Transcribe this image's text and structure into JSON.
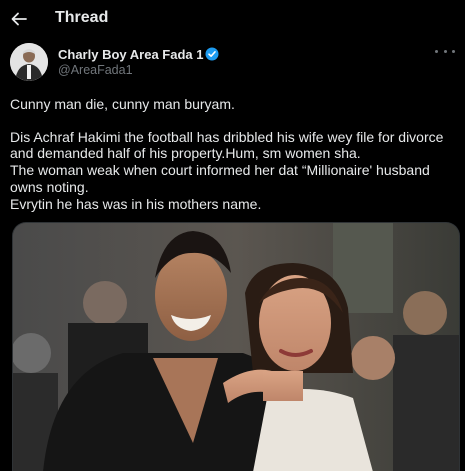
{
  "header": {
    "title": "Thread",
    "back_icon": "arrow-left-icon"
  },
  "author": {
    "display_name": "Charly Boy Area Fada 1",
    "handle": "@AreaFada1",
    "verified_icon": "verified-badge-icon",
    "more_icon": "more-horizontal-icon",
    "colors": {
      "verified": "#1d9bf0"
    }
  },
  "tweet": {
    "line1": "Cunny man die, cunny man buryam.",
    "line2": "Dis Achraf Hakimi the football has dribbled his wife wey file for divorce and demanded half of his property.Hum, sm women sha.",
    "line3": "The woman weak when court informed her  dat “Millionaire' husband owns noting.",
    "line4": "Evrytin he has was in his mothers name."
  },
  "media": {
    "image_icon": "photo"
  }
}
